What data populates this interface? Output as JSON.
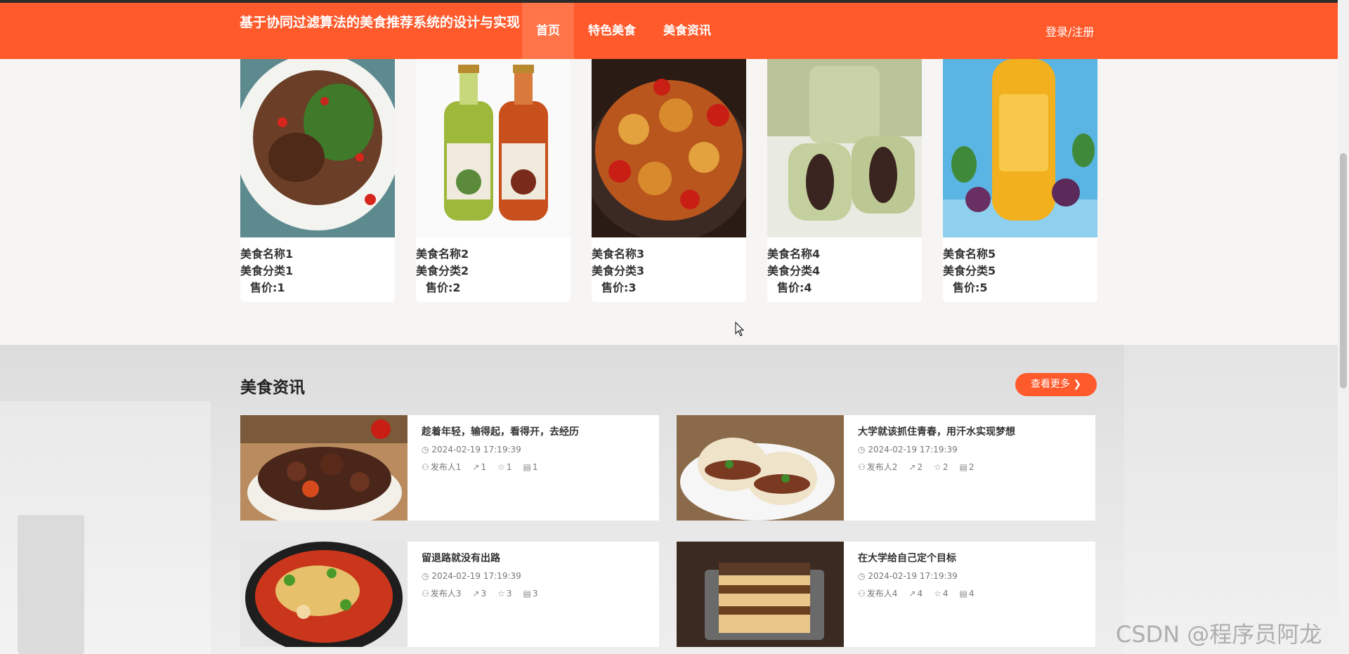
{
  "header": {
    "brand": "基于协同过滤算法的美食推荐系统的设计与实现",
    "nav": [
      "首页",
      "特色美食",
      "美食资讯"
    ],
    "login": "登录/注册",
    "accent": "#ff5a2c"
  },
  "foods": [
    {
      "name": "美食名称1",
      "category": "美食分类1",
      "price": "售价:1"
    },
    {
      "name": "美食名称2",
      "category": "美食分类2",
      "price": "售价:2"
    },
    {
      "name": "美食名称3",
      "category": "美食分类3",
      "price": "售价:3"
    },
    {
      "name": "美食名称4",
      "category": "美食分类4",
      "price": "售价:4"
    },
    {
      "name": "美食名称5",
      "category": "美食分类5",
      "price": "售价:5"
    }
  ],
  "news_section": {
    "title": "美食资讯",
    "more": "查看更多"
  },
  "news": [
    {
      "title": "趁着年轻，输得起，看得开，去经历",
      "date": "2024-02-19 17:19:39",
      "author": "发布人1",
      "likes": "1",
      "favs": "1",
      "comments": "1"
    },
    {
      "title": "大学就该抓住青春，用汗水实现梦想",
      "date": "2024-02-19 17:19:39",
      "author": "发布人2",
      "likes": "2",
      "favs": "2",
      "comments": "2"
    },
    {
      "title": "留退路就没有出路",
      "date": "2024-02-19 17:19:39",
      "author": "发布人3",
      "likes": "3",
      "favs": "3",
      "comments": "3"
    },
    {
      "title": "在大学给自己定个目标",
      "date": "2024-02-19 17:19:39",
      "author": "发布人4",
      "likes": "4",
      "favs": "4",
      "comments": "4"
    }
  ],
  "watermark": "CSDN @程序员阿龙"
}
